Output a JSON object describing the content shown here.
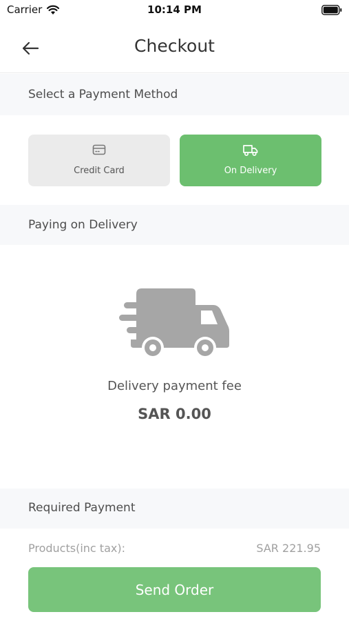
{
  "status_bar": {
    "carrier": "Carrier",
    "time": "10:14 PM",
    "wifi_icon": "wifi-icon",
    "battery_icon": "battery-icon"
  },
  "navbar": {
    "title": "Checkout",
    "back_icon": "arrow-left-icon"
  },
  "payment_method": {
    "header": "Select a Payment Method",
    "options": [
      {
        "label": "Credit Card",
        "icon": "credit-card-icon",
        "selected": false
      },
      {
        "label": "On Delivery",
        "icon": "truck-icon",
        "selected": true
      }
    ]
  },
  "delivery": {
    "header": "Paying on Delivery",
    "illustration": "delivery-truck-icon",
    "fee_label": "Delivery payment fee",
    "fee_value": "SAR 0.00"
  },
  "required_payment": {
    "header": "Required Payment",
    "products_label": "Products(inc tax):",
    "products_value": "SAR 221.95"
  },
  "actions": {
    "send_order": "Send Order"
  },
  "colors": {
    "accent_green": "#6cbf6f",
    "button_green": "#78c47b",
    "section_bg": "#f7f8fa",
    "card_gray": "#ebebeb"
  }
}
